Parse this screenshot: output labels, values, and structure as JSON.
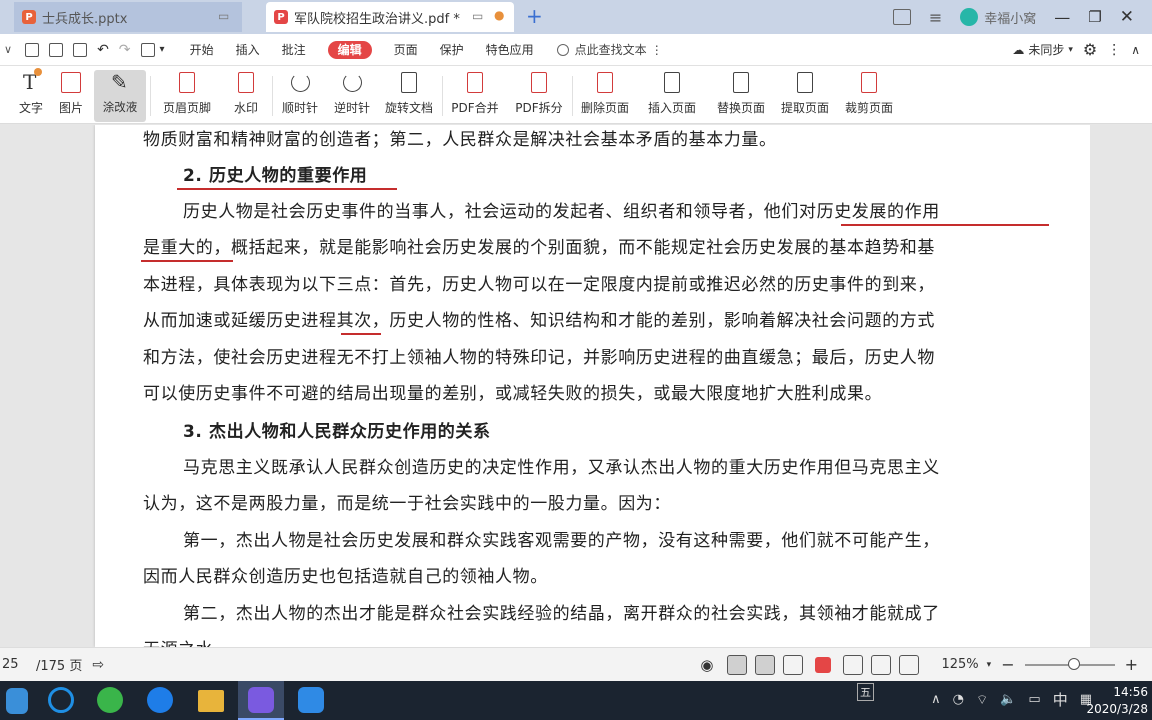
{
  "tabs": [
    {
      "label": "士兵成长.pptx",
      "badge": "P",
      "badge_color": "#e8623b",
      "active": false
    },
    {
      "label": "军队院校招生政治讲义.pdf *",
      "badge": "P",
      "badge_color": "#e44646",
      "active": true
    }
  ],
  "top_right": {
    "user": "幸福小窝"
  },
  "menu": {
    "items": [
      "开始",
      "插入",
      "批注",
      "编辑",
      "页面",
      "保护",
      "特色应用"
    ],
    "active": "编辑",
    "search_label": "点此查找文本",
    "sync_label": "未同步"
  },
  "ribbon": [
    {
      "label": "文字"
    },
    {
      "label": "图片"
    },
    {
      "label": "涂改液"
    },
    {
      "label": "页眉页脚"
    },
    {
      "label": "水印"
    },
    {
      "label": "顺时针"
    },
    {
      "label": "逆时针"
    },
    {
      "label": "旋转文档"
    },
    {
      "label": "PDF合并"
    },
    {
      "label": "PDF拆分"
    },
    {
      "label": "删除页面"
    },
    {
      "label": "插入页面"
    },
    {
      "label": "替换页面"
    },
    {
      "label": "提取页面"
    },
    {
      "label": "裁剪页面"
    }
  ],
  "document": {
    "lines": [
      "物质财富和精神财富的创造者；第二，人民群众是解决社会基本矛盾的基本力量。",
      "2. 历史人物的重要作用",
      "历史人物是社会历史事件的当事人，社会运动的发起者、组织者和领导者，他们对历史发展的作用",
      "是重大的，概括起来，就是能影响社会历史发展的个别面貌，而不能规定社会历史发展的基本趋势和基",
      "本进程，具体表现为以下三点：首先，历史人物可以在一定限度内提前或推迟必然的历史事件的到来，",
      "从而加速或延缓历史进程其次，历史人物的性格、知识结构和才能的差别，影响着解决社会问题的方式",
      "和方法，使社会历史进程无不打上领袖人物的特殊印记，并影响历史进程的曲直缓急；最后，历史人物",
      "可以使历史事件不可避的结局出现量的差别，或减轻失败的损失，或最大限度地扩大胜利成果。",
      "3. 杰出人物和人民群众历史作用的关系",
      "马克思主义既承认人民群众创造历史的决定性作用，又承认杰出人物的重大历史作用但马克思主义",
      "认为，这不是两股力量，而是统一于社会实践中的一股力量。因为：",
      "第一，杰出人物是社会历史发展和群众实践客观需要的产物，没有这种需要，他们就不可能产生，",
      "因而人民群众创造历史也包括造就自己的领袖人物。",
      "第二，杰出人物的杰出才能是群众社会实践经验的结晶，离开群众的社会实践，其领袖才能就成了",
      "无源之水"
    ]
  },
  "status": {
    "page": "25",
    "total": "/175 页",
    "zoom": "125%",
    "zoom_fraction": 0.55
  },
  "taskbar": {
    "ime": "中",
    "ime_box": "五",
    "time": "14:56",
    "date": "2020/3/28"
  },
  "colors": {
    "accent": "#e44646",
    "underline": "#c52d2d",
    "tabbar": "#c9d4e6"
  }
}
